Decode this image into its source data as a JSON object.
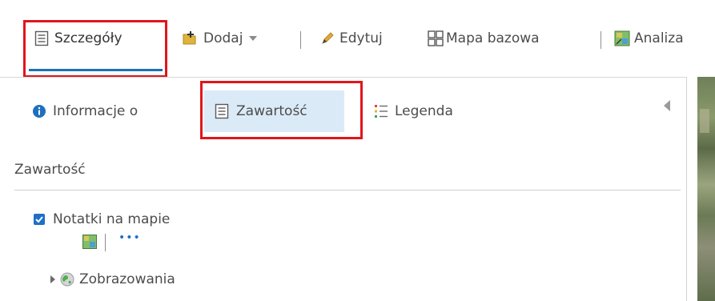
{
  "toolbar": {
    "details_label": "Szczegóły",
    "add_label": "Dodaj",
    "edit_label": "Edytuj",
    "basemap_label": "Mapa bazowa",
    "analysis_label": "Analiza"
  },
  "panel": {
    "tabs": [
      {
        "label": "Informacje o"
      },
      {
        "label": "Zawartość"
      },
      {
        "label": "Legenda"
      }
    ],
    "section_title": "Zawartość",
    "layers": [
      {
        "name": "Notatki na mapie",
        "checked": true
      },
      {
        "name": "Zobrazowania",
        "checked": false
      }
    ]
  },
  "colors": {
    "accent": "#1a73b8",
    "highlight_box": "#e0161c",
    "active_tab_bg": "#dbeaf7",
    "checkbox": "#1e6fc7"
  },
  "icons": {
    "details": "document-list-icon",
    "add": "add-data-icon",
    "edit": "pencil-icon",
    "basemap": "basemap-grid-icon",
    "analysis": "analysis-icon",
    "info": "info-circle-icon",
    "content": "content-list-icon",
    "legend": "legend-icon",
    "collapse": "collapse-left-icon",
    "layer_symbol": "layer-symbol-icon",
    "more": "more-options-icon",
    "globe": "globe-icon"
  }
}
